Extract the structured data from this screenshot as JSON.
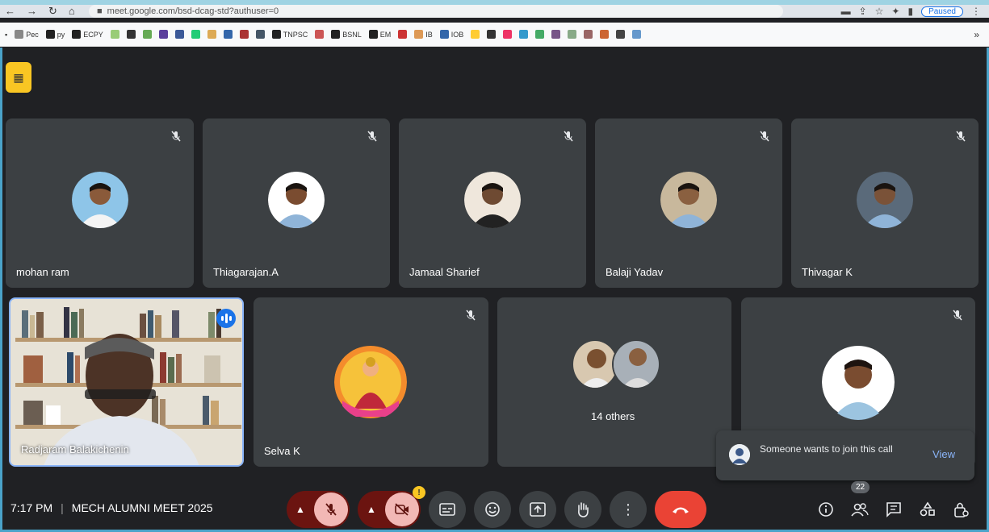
{
  "browser": {
    "url": "meet.google.com/bsd-dcag-std?authuser=0",
    "profile_status": "Paused",
    "bookmarks": [
      {
        "label": "Pec",
        "color": "#888"
      },
      {
        "label": "py",
        "color": "#222"
      },
      {
        "label": "ECPY",
        "color": "#222"
      },
      {
        "label": "",
        "color": "#9c7"
      },
      {
        "label": "",
        "color": "#333"
      },
      {
        "label": "",
        "color": "#6a5"
      },
      {
        "label": "",
        "color": "#5b3e9c"
      },
      {
        "label": "",
        "color": "#3b5998"
      },
      {
        "label": "",
        "color": "#2c7"
      },
      {
        "label": "",
        "color": "#da5"
      },
      {
        "label": "",
        "color": "#36a"
      },
      {
        "label": "",
        "color": "#a33"
      },
      {
        "label": "",
        "color": "#456"
      },
      {
        "label": "TNPSC",
        "color": "#222"
      },
      {
        "label": "",
        "color": "#c55"
      },
      {
        "label": "BSNL",
        "color": "#222"
      },
      {
        "label": "EM",
        "color": "#222"
      },
      {
        "label": "",
        "color": "#c33"
      },
      {
        "label": "IB",
        "color": "#d95"
      },
      {
        "label": "IOB",
        "color": "#36a"
      },
      {
        "label": "",
        "color": "#fc3"
      },
      {
        "label": "",
        "color": "#333"
      },
      {
        "label": "",
        "color": "#e36"
      },
      {
        "label": "",
        "color": "#39c"
      },
      {
        "label": "",
        "color": "#4a6"
      },
      {
        "label": "",
        "color": "#758"
      },
      {
        "label": "",
        "color": "#8a8"
      },
      {
        "label": "",
        "color": "#966"
      },
      {
        "label": "",
        "color": "#c63"
      },
      {
        "label": "",
        "color": "#444"
      },
      {
        "label": "",
        "color": "#69c"
      }
    ],
    "more": "»"
  },
  "participants_row1": [
    {
      "name": "mohan ram",
      "avatar_bg": "#8ec5e8",
      "skin": "#8a5a3a"
    },
    {
      "name": "Thiagarajan.A",
      "avatar_bg": "#ffffff",
      "skin": "#7a4c30"
    },
    {
      "name": "Jamaal Sharief",
      "avatar_bg": "#efe7dc",
      "skin": "#6e4a32"
    },
    {
      "name": "Balaji Yadav",
      "avatar_bg": "#c8b89c",
      "skin": "#8a6040"
    },
    {
      "name": "Thivagar K",
      "avatar_bg": "#5a6a7a",
      "skin": "#7a5238"
    }
  ],
  "participants_row2": [
    {
      "name": "Radjaram Balakichenin",
      "type": "video"
    },
    {
      "name": "Selva K",
      "type": "avatar",
      "avatar_bg": "#f48c2c"
    },
    {
      "name": "14 others",
      "type": "others"
    },
    {
      "name": "",
      "type": "avatar",
      "avatar_bg": "#ffffff"
    }
  ],
  "toast": {
    "message": "Someone wants to join this call",
    "action": "View"
  },
  "footer": {
    "time": "7:17 PM",
    "separator": "|",
    "meeting_name": "MECH ALUMNI MEET 2025",
    "people_count": "22",
    "camera_warning": "!"
  }
}
